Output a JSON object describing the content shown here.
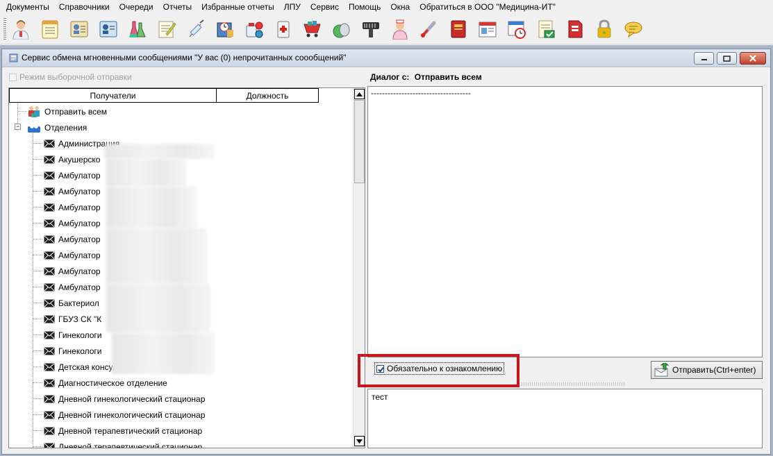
{
  "menu": [
    "Документы",
    "Справочники",
    "Очереди",
    "Отчеты",
    "Избранные отчеты",
    "ЛПУ",
    "Сервис",
    "Помощь",
    "Окна",
    "Обратиться в ООО \"Медицина-ИТ\""
  ],
  "toolbar": {
    "icons": [
      "doctor-icon",
      "notepad-icon",
      "id-card-icon",
      "id-card-blue-icon",
      "lab-flasks-icon",
      "edit-document-icon",
      "syringe-icon",
      "clock-book-icon",
      "pills-icon",
      "first-aid-kit-icon",
      "cart-icon",
      "gel-icon",
      "barcode-scanner-icon",
      "nurse-icon",
      "thermometer-icon",
      "red-book-icon",
      "calendar-card-icon",
      "calendar-clock-icon",
      "signed-document-icon",
      "red-document-icon",
      "lock-icon",
      "chat-bubble-icon"
    ]
  },
  "window": {
    "title": "Сервис обмена мгновенными сообщениями \"У вас (0) непрочитанных соообщений\""
  },
  "left": {
    "mode_label": "Режим выборочной отправки",
    "col_recipients": "Получатели",
    "col_position": "Должность",
    "send_all": "Отправить всем",
    "departments": "Отделения",
    "items": [
      "Администрация",
      "Акушерско",
      "Амбулатор",
      "Амбулатор",
      "Амбулатор",
      "Амбулатор",
      "Амбулатор",
      "Амбулатор",
      "Амбулатор",
      "Амбулатор",
      "Бактериол",
      "ГБУЗ СК \"К",
      "Гинекологи",
      "Гинекологи",
      "Детская консультация поликлиники Кі",
      "Диагностическое отделение",
      "Дневной гинекологический стационар",
      "Дневной гинекологический стационар",
      "Дневной терапевтический стационар",
      "Дневной терапевтический стационар"
    ]
  },
  "right": {
    "dialog_prefix": "Диалог с:",
    "dialog_target": "Отправить всем",
    "history_text": "------------------------------------",
    "mandatory_label": "Обязательно к ознакомлению",
    "send_label": "Отправить(Ctrl+enter)",
    "input_text": "тест"
  },
  "colors": {
    "highlight": "#c8161d",
    "mdi_background": "#a9b4c4"
  }
}
